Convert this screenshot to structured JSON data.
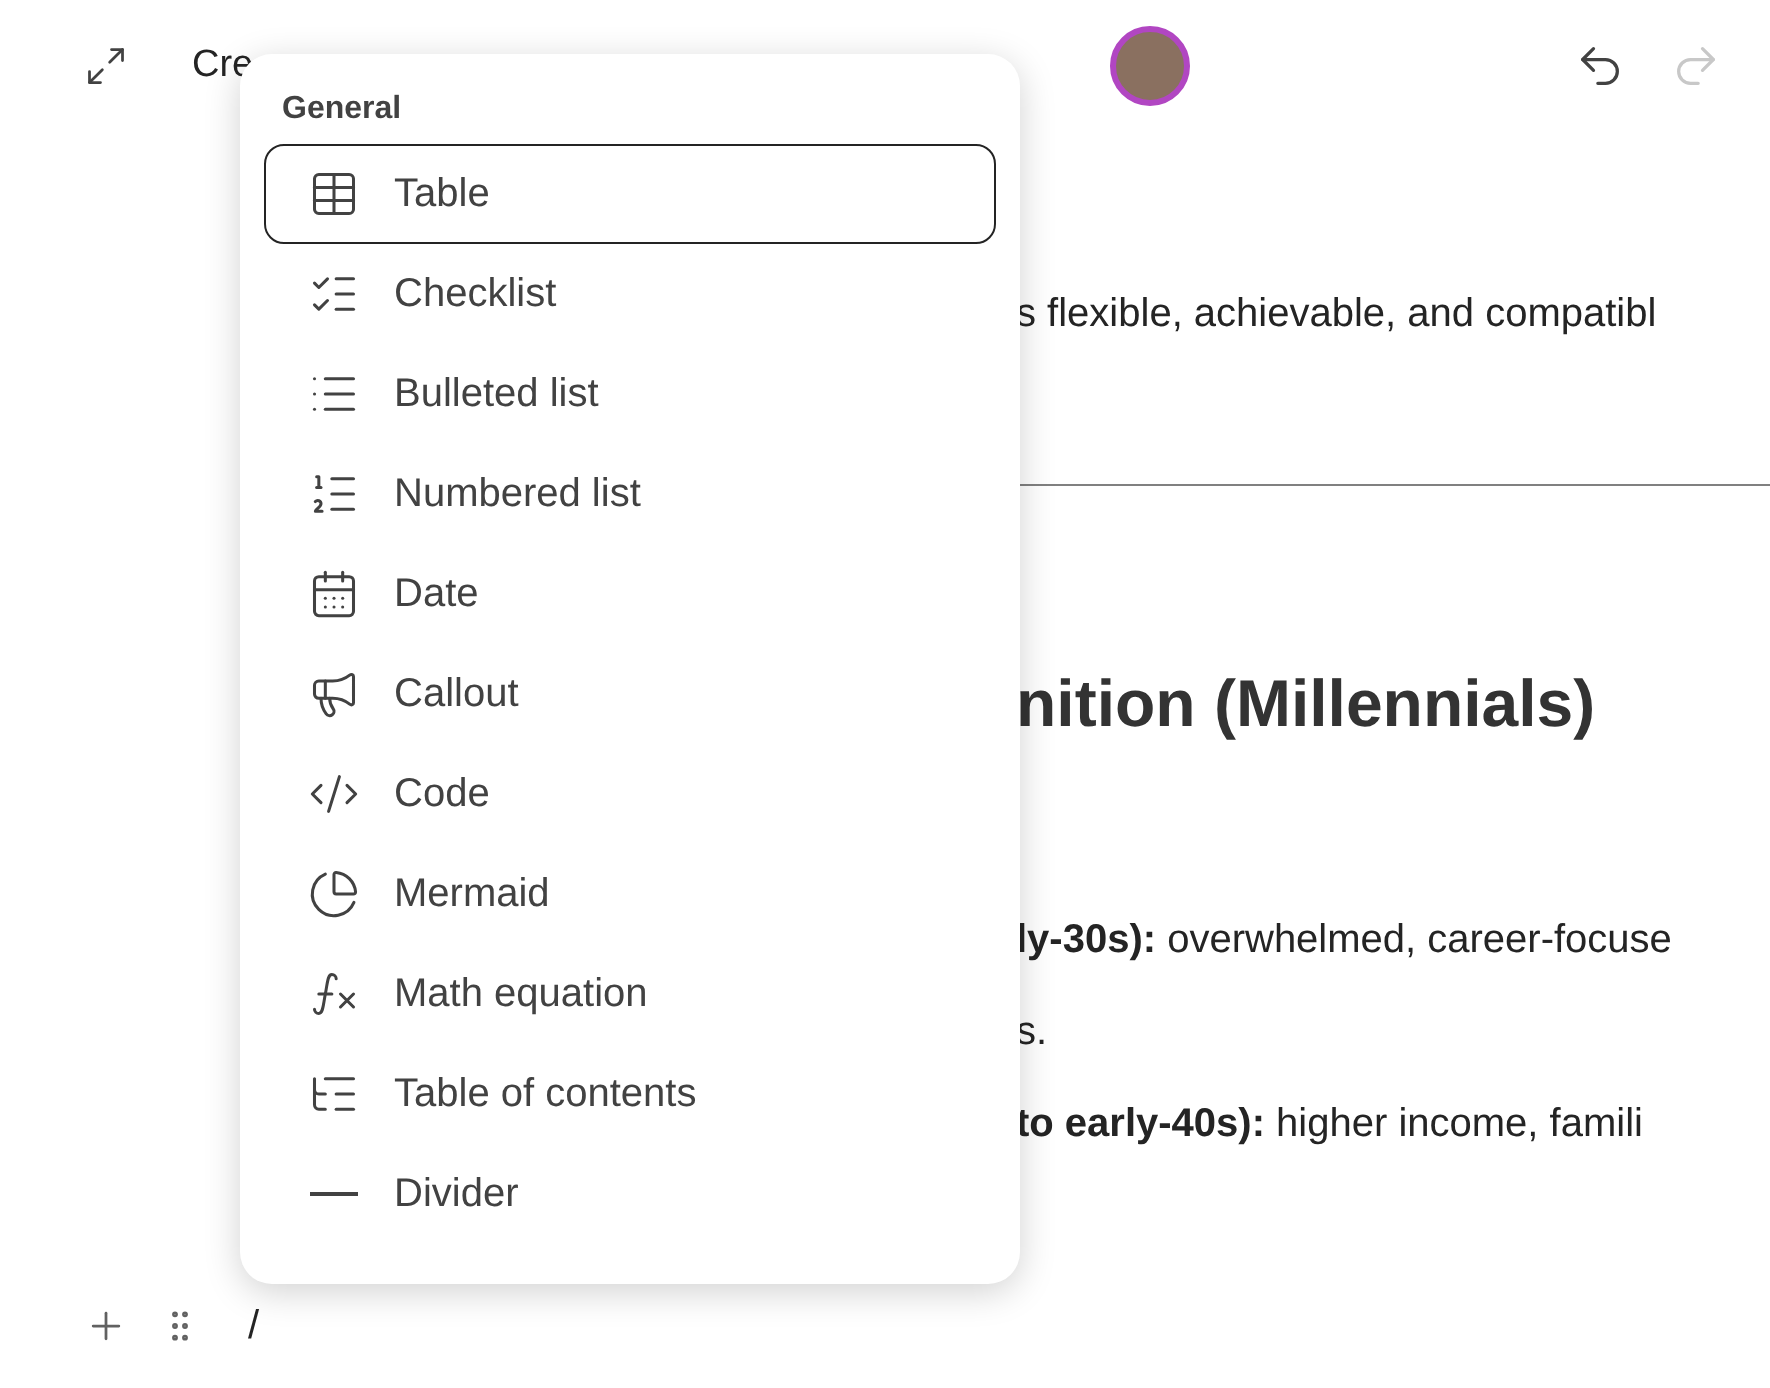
{
  "toolbar": {
    "title": "Cre",
    "undo": {
      "disabled": false
    },
    "redo": {
      "disabled": true
    }
  },
  "document": {
    "paragraph": "s flexible, achievable, and compatibl",
    "heading": "nition (Millennials)",
    "lines": [
      "**ly-30s):** overwhelmed, career-focuse",
      "s.",
      "**to early-40s):** higher income, famili"
    ]
  },
  "insert_menu": {
    "section": "General",
    "items": [
      {
        "label": "Table",
        "kind": "table",
        "selected": true
      },
      {
        "label": "Checklist",
        "kind": "checklist",
        "selected": false
      },
      {
        "label": "Bulleted list",
        "kind": "bullets",
        "selected": false
      },
      {
        "label": "Numbered list",
        "kind": "numbers",
        "selected": false
      },
      {
        "label": "Date",
        "kind": "date",
        "selected": false
      },
      {
        "label": "Callout",
        "kind": "callout",
        "selected": false
      },
      {
        "label": "Code",
        "kind": "code",
        "selected": false
      },
      {
        "label": "Mermaid",
        "kind": "diagram",
        "selected": false
      },
      {
        "label": "Math equation",
        "kind": "math",
        "selected": false
      },
      {
        "label": "Table of contents",
        "kind": "toc",
        "selected": false
      },
      {
        "label": "Divider",
        "kind": "divider",
        "selected": false
      }
    ]
  },
  "editor_line": {
    "typed": "/"
  }
}
